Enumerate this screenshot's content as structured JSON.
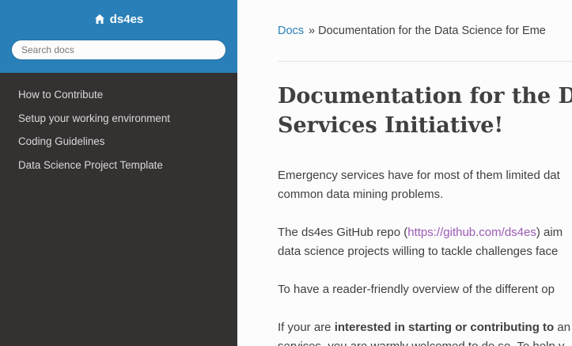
{
  "sidebar": {
    "brand": "ds4es",
    "search_placeholder": "Search docs",
    "items": [
      {
        "label": "How to Contribute"
      },
      {
        "label": "Setup your working environment"
      },
      {
        "label": "Coding Guidelines"
      },
      {
        "label": "Data Science Project Template"
      }
    ]
  },
  "breadcrumb": {
    "home": "Docs",
    "separator": "»",
    "current": "Documentation for the Data Science for Eme"
  },
  "main": {
    "title_line1": "Documentation for the Data",
    "title_line2": "Services Initiative!",
    "p1_line1": "Emergency services have for most of them limited dat",
    "p1_line2": "common data mining problems.",
    "p2_pre": "The ds4es GitHub repo (",
    "p2_link": "https://github.com/ds4es",
    "p2_post": ") aim",
    "p2_line2": "data science projects willing to tackle challenges face",
    "p3_line1": "To have a reader-friendly overview of the different op",
    "p4_pre": "If your are ",
    "p4_bold": "interested in starting or contributing to",
    "p4_post": " an",
    "p4_line2": "services, you are warmly welcomed to do so. To help y"
  },
  "colors": {
    "sidebar_bg": "#343131",
    "sidebar_top": "#2980b9",
    "link": "#2980b9",
    "visited_link": "#9b59b6",
    "text": "#404040"
  }
}
